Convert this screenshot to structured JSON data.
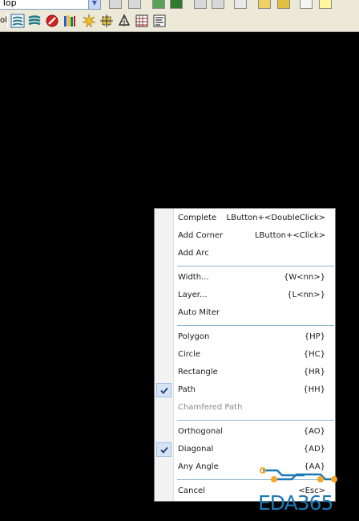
{
  "toolbar": {
    "layer_select_value": "Top",
    "layer_prefix": "ol"
  },
  "menu": {
    "items": [
      {
        "label": "Complete",
        "shortcut": "LButton+<DoubleClick>"
      },
      {
        "label": "Add Corner",
        "shortcut": "LButton+<Click>"
      },
      {
        "label": "Add Arc",
        "shortcut": ""
      },
      {
        "label": "Width...",
        "shortcut": "{W<nn>}"
      },
      {
        "label": "Layer...",
        "shortcut": "{L<nn>}"
      },
      {
        "label": "Auto Miter",
        "shortcut": ""
      },
      {
        "label": "Polygon",
        "shortcut": "{HP}"
      },
      {
        "label": "Circle",
        "shortcut": "{HC}"
      },
      {
        "label": "Rectangle",
        "shortcut": "{HR}"
      },
      {
        "label": "Path",
        "shortcut": "{HH}",
        "checked": true
      },
      {
        "label": "Chamfered Path",
        "shortcut": "",
        "disabled": true
      },
      {
        "label": "Orthogonal",
        "shortcut": "{AO}"
      },
      {
        "label": "Diagonal",
        "shortcut": "{AD}",
        "checked": true
      },
      {
        "label": "Any Angle",
        "shortcut": "{AA}"
      },
      {
        "label": "Cancel",
        "shortcut": "<Esc>"
      }
    ]
  },
  "watermark": {
    "text": "EDA365"
  },
  "colors": {
    "canvas": "#000000",
    "menu_separator": "#8eb6cf",
    "watermark_blue": "#1b78b4",
    "watermark_orange": "#f5a623"
  }
}
